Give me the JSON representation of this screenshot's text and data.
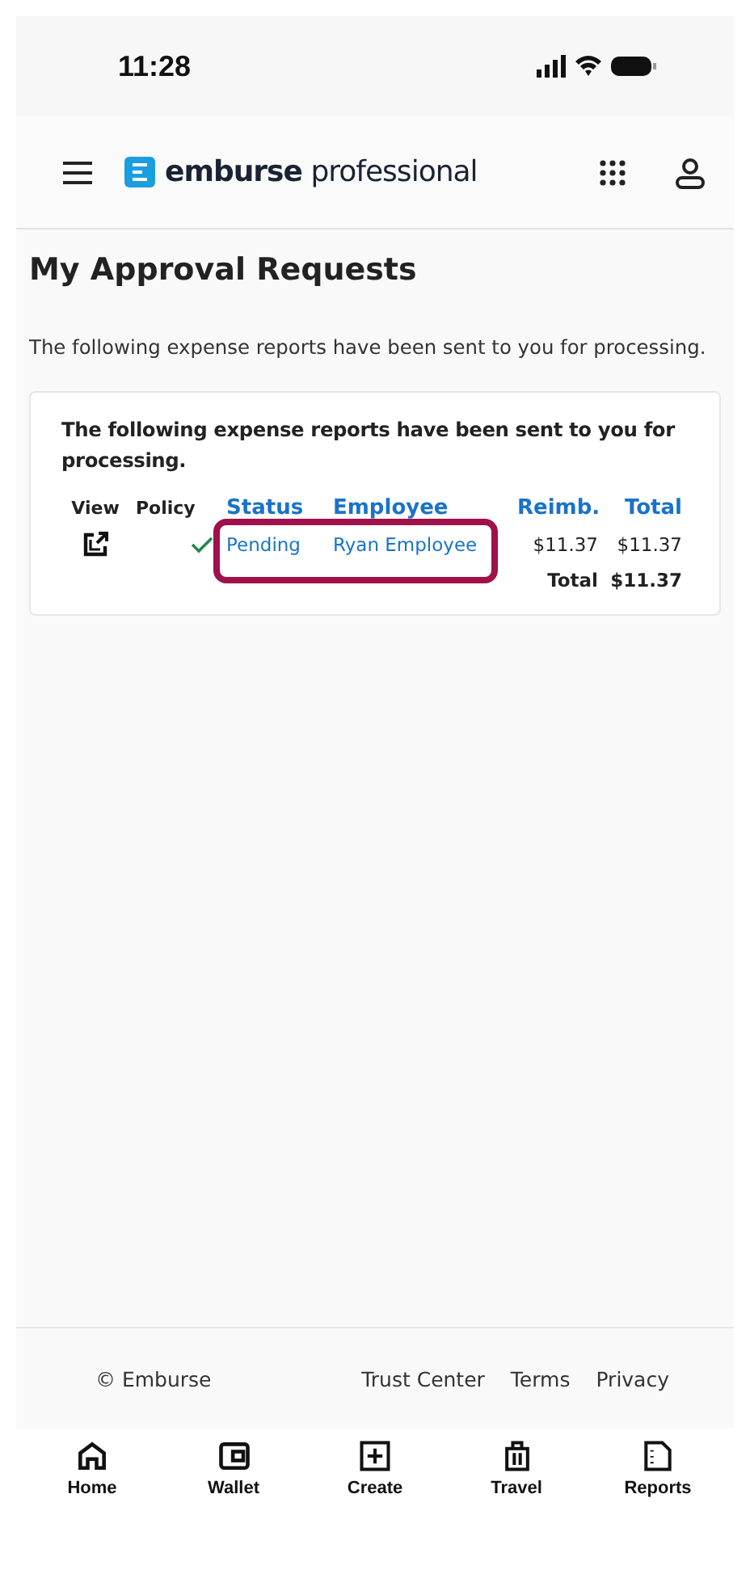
{
  "status_bar": {
    "time": "11:28"
  },
  "header": {
    "brand": "emburse",
    "product": "professional"
  },
  "page": {
    "title": "My Approval Requests",
    "intro": "The following expense reports have been sent to you for processing."
  },
  "card": {
    "message": "The following expense reports have been sent to you for processing.",
    "columns": [
      {
        "label": "View",
        "kind": "plain"
      },
      {
        "label": "Policy",
        "kind": "plain"
      },
      {
        "label": "Status",
        "kind": "link"
      },
      {
        "label": "Employee",
        "kind": "link"
      },
      {
        "label": "Reimb.",
        "kind": "link"
      },
      {
        "label": "Total",
        "kind": "link"
      }
    ],
    "rows": [
      {
        "policy_ok": true,
        "status": "Pending",
        "employee": "Ryan Employee",
        "reimb": "$11.37",
        "total": "$11.37",
        "highlighted": true
      }
    ],
    "total_label": "Total",
    "total_value": "$11.37"
  },
  "footer": {
    "copyright": "© Emburse",
    "links": [
      "Trust Center",
      "Terms",
      "Privacy"
    ]
  },
  "tabbar": [
    {
      "label": "Home",
      "kind": "home"
    },
    {
      "label": "Wallet",
      "kind": "wallet"
    },
    {
      "label": "Create",
      "kind": "create"
    },
    {
      "label": "Travel",
      "kind": "travel"
    },
    {
      "label": "Reports",
      "kind": "reports"
    }
  ]
}
